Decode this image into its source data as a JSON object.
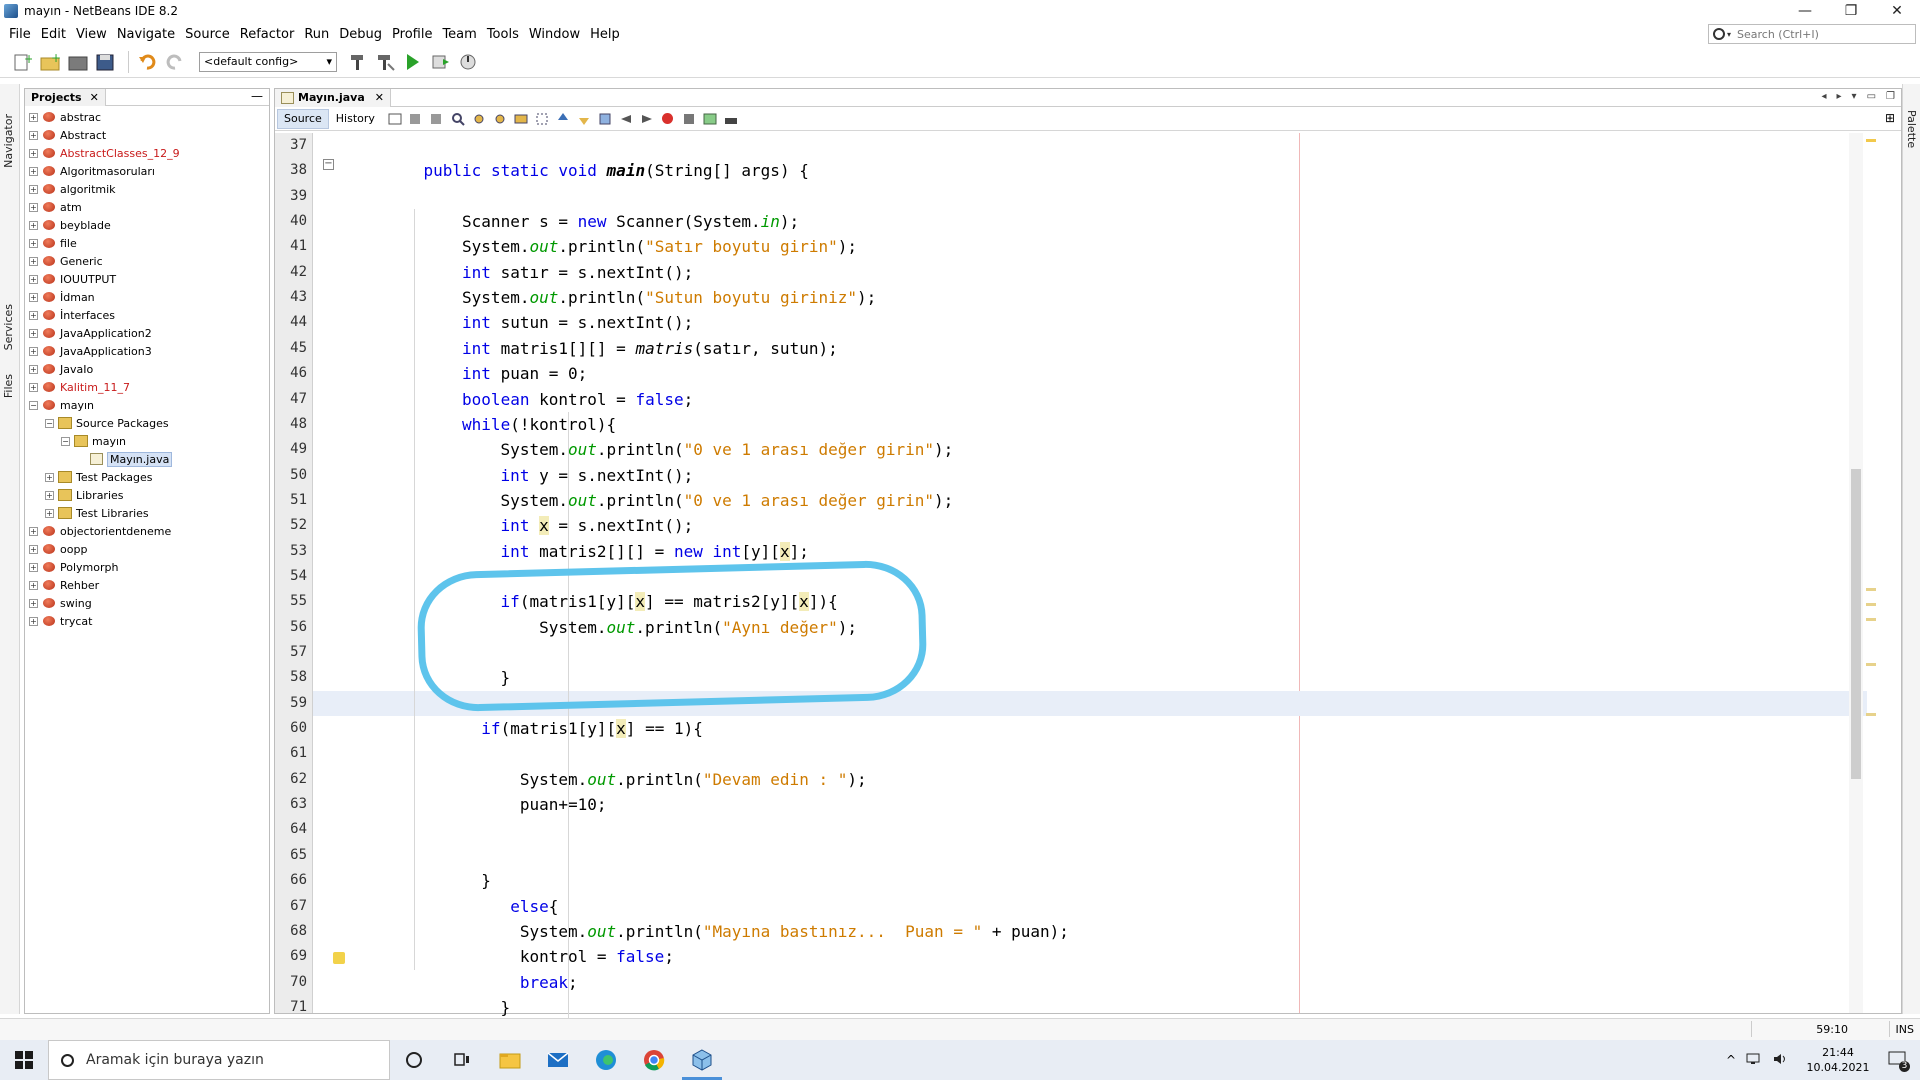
{
  "window": {
    "title": "mayın - NetBeans IDE 8.2",
    "controls": [
      "—",
      "❐",
      "✕"
    ]
  },
  "menu": [
    "File",
    "Edit",
    "View",
    "Navigate",
    "Source",
    "Refactor",
    "Run",
    "Debug",
    "Profile",
    "Team",
    "Tools",
    "Window",
    "Help"
  ],
  "search": {
    "placeholder": "Search (Ctrl+I)"
  },
  "toolbar": {
    "config": "<default config>"
  },
  "left_strip": {
    "tabs": [
      "Navigator",
      "Services",
      "Files"
    ]
  },
  "right_strip": {
    "tabs": [
      "Palette"
    ]
  },
  "projects": {
    "tab_label": "Projects",
    "tree": [
      {
        "label": "abstrac",
        "level": 0,
        "type": "project",
        "expanded": false,
        "error": false
      },
      {
        "label": "Abstract",
        "level": 0,
        "type": "project",
        "expanded": false,
        "error": false
      },
      {
        "label": "AbstractClasses_12_9",
        "level": 0,
        "type": "project",
        "expanded": false,
        "error": true
      },
      {
        "label": "Algoritmasoruları",
        "level": 0,
        "type": "project",
        "expanded": false,
        "error": false
      },
      {
        "label": "algoritmik",
        "level": 0,
        "type": "project",
        "expanded": false,
        "error": false
      },
      {
        "label": "atm",
        "level": 0,
        "type": "project",
        "expanded": false,
        "error": false
      },
      {
        "label": "beyblade",
        "level": 0,
        "type": "project",
        "expanded": false,
        "error": false
      },
      {
        "label": "file",
        "level": 0,
        "type": "project",
        "expanded": false,
        "error": false
      },
      {
        "label": "Generic",
        "level": 0,
        "type": "project",
        "expanded": false,
        "error": false
      },
      {
        "label": "IOUUTPUT",
        "level": 0,
        "type": "project",
        "expanded": false,
        "error": false
      },
      {
        "label": "İdman",
        "level": 0,
        "type": "project",
        "expanded": false,
        "error": false
      },
      {
        "label": "İnterfaces",
        "level": 0,
        "type": "project",
        "expanded": false,
        "error": false
      },
      {
        "label": "JavaApplication2",
        "level": 0,
        "type": "project",
        "expanded": false,
        "error": false
      },
      {
        "label": "JavaApplication3",
        "level": 0,
        "type": "project",
        "expanded": false,
        "error": false
      },
      {
        "label": "JavaIo",
        "level": 0,
        "type": "project",
        "expanded": false,
        "error": false
      },
      {
        "label": "Kalitim_11_7",
        "level": 0,
        "type": "project",
        "expanded": false,
        "error": true
      },
      {
        "label": "mayın",
        "level": 0,
        "type": "project",
        "expanded": true,
        "error": false
      },
      {
        "label": "Source Packages",
        "level": 1,
        "type": "package",
        "expanded": true,
        "error": false
      },
      {
        "label": "mayın",
        "level": 2,
        "type": "package",
        "expanded": true,
        "error": false
      },
      {
        "label": "Mayın.java",
        "level": 3,
        "type": "file",
        "expanded": null,
        "error": false,
        "selected": true
      },
      {
        "label": "Test Packages",
        "level": 1,
        "type": "package",
        "expanded": false,
        "error": false
      },
      {
        "label": "Libraries",
        "level": 1,
        "type": "package",
        "expanded": false,
        "error": false
      },
      {
        "label": "Test Libraries",
        "level": 1,
        "type": "package",
        "expanded": false,
        "error": false
      },
      {
        "label": "objectorientdeneme",
        "level": 0,
        "type": "project",
        "expanded": false,
        "error": false
      },
      {
        "label": "oopp",
        "level": 0,
        "type": "project",
        "expanded": false,
        "error": false
      },
      {
        "label": "Polymorph",
        "level": 0,
        "type": "project",
        "expanded": false,
        "error": false
      },
      {
        "label": "Rehber",
        "level": 0,
        "type": "project",
        "expanded": false,
        "error": false
      },
      {
        "label": "swing",
        "level": 0,
        "type": "project",
        "expanded": false,
        "error": false
      },
      {
        "label": "trycat",
        "level": 0,
        "type": "project",
        "expanded": false,
        "error": false
      }
    ]
  },
  "editor": {
    "tab_label": "Mayın.java",
    "source_label": "Source",
    "history_label": "History",
    "current_line": 59,
    "lines": [
      {
        "n": 37,
        "indent": 0,
        "tokens": []
      },
      {
        "n": 38,
        "indent": 4,
        "tokens": [
          [
            "kw",
            "public static void "
          ],
          [
            "bold",
            "main"
          ],
          [
            "",
            "(String[] args) {"
          ]
        ]
      },
      {
        "n": 39,
        "indent": 0,
        "tokens": []
      },
      {
        "n": 40,
        "indent": 8,
        "tokens": [
          [
            "",
            "Scanner s = "
          ],
          [
            "kw",
            "new"
          ],
          [
            "",
            " Scanner(System."
          ],
          [
            "fld",
            "in"
          ],
          [
            "",
            ");"
          ]
        ]
      },
      {
        "n": 41,
        "indent": 8,
        "tokens": [
          [
            "",
            "System."
          ],
          [
            "fld",
            "out"
          ],
          [
            "",
            ".println("
          ],
          [
            "str",
            "\"Satır boyutu girin\""
          ],
          [
            "",
            ");"
          ]
        ]
      },
      {
        "n": 42,
        "indent": 8,
        "tokens": [
          [
            "kw",
            "int"
          ],
          [
            "",
            " satır = s.nextInt();"
          ]
        ]
      },
      {
        "n": 43,
        "indent": 8,
        "tokens": [
          [
            "",
            "System."
          ],
          [
            "fld",
            "out"
          ],
          [
            "",
            ".println("
          ],
          [
            "str",
            "\"Sutun boyutu giriniz\""
          ],
          [
            "",
            ");"
          ]
        ]
      },
      {
        "n": 44,
        "indent": 8,
        "tokens": [
          [
            "kw",
            "int"
          ],
          [
            "",
            " sutun = s.nextInt();"
          ]
        ]
      },
      {
        "n": 45,
        "indent": 8,
        "tokens": [
          [
            "kw",
            "int"
          ],
          [
            "",
            " matris1[][] = "
          ],
          [
            "mth",
            "matris"
          ],
          [
            "",
            "(satır, sutun);"
          ]
        ]
      },
      {
        "n": 46,
        "indent": 8,
        "tokens": [
          [
            "kw",
            "int"
          ],
          [
            "",
            " puan = 0;"
          ]
        ]
      },
      {
        "n": 47,
        "indent": 8,
        "tokens": [
          [
            "kw",
            "boolean"
          ],
          [
            "",
            " kontrol = "
          ],
          [
            "kw",
            "false"
          ],
          [
            "",
            ";"
          ]
        ]
      },
      {
        "n": 48,
        "indent": 8,
        "tokens": [
          [
            "kw",
            "while"
          ],
          [
            "",
            "(!kontrol){"
          ]
        ]
      },
      {
        "n": 49,
        "indent": 12,
        "tokens": [
          [
            "",
            "System."
          ],
          [
            "fld",
            "out"
          ],
          [
            "",
            ".println("
          ],
          [
            "str",
            "\"0 ve 1 arası değer girin\""
          ],
          [
            "",
            ");"
          ]
        ]
      },
      {
        "n": 50,
        "indent": 12,
        "tokens": [
          [
            "kw",
            "int"
          ],
          [
            "",
            " y = s.nextInt();"
          ]
        ]
      },
      {
        "n": 51,
        "indent": 12,
        "tokens": [
          [
            "",
            "System."
          ],
          [
            "fld",
            "out"
          ],
          [
            "",
            ".println("
          ],
          [
            "str",
            "\"0 ve 1 arası değer girin\""
          ],
          [
            "",
            ");"
          ]
        ]
      },
      {
        "n": 52,
        "indent": 12,
        "tokens": [
          [
            "kw",
            "int"
          ],
          [
            "",
            " "
          ],
          [
            "hl",
            "x"
          ],
          [
            "",
            " = s.nextInt();"
          ]
        ]
      },
      {
        "n": 53,
        "indent": 12,
        "tokens": [
          [
            "kw",
            "int"
          ],
          [
            "",
            " matris2[][] = "
          ],
          [
            "kw",
            "new"
          ],
          [
            "",
            " "
          ],
          [
            "kw",
            "int"
          ],
          [
            "",
            "[y]["
          ],
          [
            "hl",
            "x"
          ],
          [
            "",
            "];"
          ]
        ]
      },
      {
        "n": 54,
        "indent": 0,
        "tokens": []
      },
      {
        "n": 55,
        "indent": 12,
        "tokens": [
          [
            "kw",
            "if"
          ],
          [
            "",
            "(matris1[y]["
          ],
          [
            "hl",
            "x"
          ],
          [
            "",
            "] == matris2[y]["
          ],
          [
            "hl",
            "x"
          ],
          [
            "",
            "]){"
          ]
        ]
      },
      {
        "n": 56,
        "indent": 16,
        "tokens": [
          [
            "",
            "System."
          ],
          [
            "fld",
            "out"
          ],
          [
            "",
            ".println("
          ],
          [
            "str",
            "\"Aynı değer\""
          ],
          [
            "",
            ");"
          ]
        ]
      },
      {
        "n": 57,
        "indent": 0,
        "tokens": []
      },
      {
        "n": 58,
        "indent": 12,
        "tokens": [
          [
            "",
            "}"
          ]
        ]
      },
      {
        "n": 59,
        "indent": 0,
        "tokens": []
      },
      {
        "n": 60,
        "indent": 10,
        "tokens": [
          [
            "kw",
            "if"
          ],
          [
            "",
            "(matris1[y]["
          ],
          [
            "hl",
            "x"
          ],
          [
            "",
            "] == 1){"
          ]
        ]
      },
      {
        "n": 61,
        "indent": 0,
        "tokens": []
      },
      {
        "n": 62,
        "indent": 14,
        "tokens": [
          [
            "",
            "System."
          ],
          [
            "fld",
            "out"
          ],
          [
            "",
            ".println("
          ],
          [
            "str",
            "\"Devam edin : \""
          ],
          [
            "",
            ");"
          ]
        ]
      },
      {
        "n": 63,
        "indent": 14,
        "tokens": [
          [
            "",
            "puan+=10;"
          ]
        ]
      },
      {
        "n": 64,
        "indent": 0,
        "tokens": []
      },
      {
        "n": 65,
        "indent": 0,
        "tokens": []
      },
      {
        "n": 66,
        "indent": 10,
        "tokens": [
          [
            "",
            "}"
          ]
        ]
      },
      {
        "n": 67,
        "indent": 13,
        "tokens": [
          [
            "kw",
            "else"
          ],
          [
            "",
            "{"
          ]
        ]
      },
      {
        "n": 68,
        "indent": 14,
        "tokens": [
          [
            "",
            "System."
          ],
          [
            "fld",
            "out"
          ],
          [
            "",
            ".println("
          ],
          [
            "str",
            "\"Mayına bastınız...  Puan = \""
          ],
          [
            "",
            " + puan);"
          ]
        ]
      },
      {
        "n": 69,
        "indent": 14,
        "tokens": [
          [
            "",
            "kontrol = "
          ],
          [
            "kw",
            "false"
          ],
          [
            "",
            ";"
          ]
        ]
      },
      {
        "n": 70,
        "indent": 14,
        "tokens": [
          [
            "kw",
            "break"
          ],
          [
            "",
            ";"
          ]
        ]
      },
      {
        "n": 71,
        "indent": 12,
        "tokens": [
          [
            "",
            "}"
          ]
        ]
      }
    ]
  },
  "status": {
    "position": "59:10",
    "mode": "INS"
  },
  "taskbar": {
    "search_placeholder": "Aramak için buraya yazın",
    "time": "21:44",
    "date": "10.04.2021",
    "notification_count": "3"
  },
  "colors": {
    "keyword": "#0000e6",
    "string": "#ce7b00",
    "field": "#009900",
    "annotation_circle": "#5ec4ec"
  }
}
